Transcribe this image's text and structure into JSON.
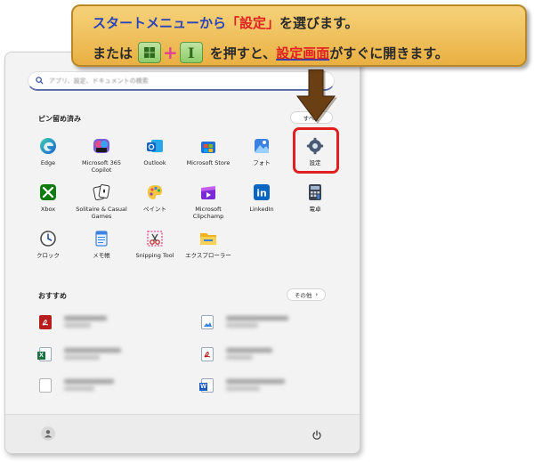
{
  "callout": {
    "line1_part1": "スタートメニューから",
    "line1_highlight": "「設定」",
    "line1_part2": "を選びます。",
    "line2_part1": "または",
    "key1_icon": "windows-key-icon",
    "plus": "+",
    "key2_label": "I",
    "line2_part2": "を押すと、",
    "line2_highlight": "設定画面",
    "line2_part3": "がすぐに開きます。",
    "colors": {
      "accent_blue": "#2a44b8",
      "accent_red": "#e02020",
      "key_green": "#8ecc6b",
      "callout_bg": "#f6d27a"
    }
  },
  "start_menu": {
    "search_placeholder": "アプリ、設定、ドキュメントの検索",
    "pinned_title": "ピン留め済み",
    "all_apps_label": "すべて",
    "recommended_title": "おすすめ",
    "more_label": "その他",
    "pinned_apps": [
      {
        "label": "Edge",
        "icon": "edge-icon"
      },
      {
        "label": "Microsoft 365 Copilot",
        "icon": "m365-copilot-icon"
      },
      {
        "label": "Outlook",
        "icon": "outlook-icon"
      },
      {
        "label": "Microsoft Store",
        "icon": "store-icon"
      },
      {
        "label": "フォト",
        "icon": "photos-icon"
      },
      {
        "label": "設定",
        "icon": "gear-icon"
      },
      {
        "label": "Xbox",
        "icon": "xbox-icon"
      },
      {
        "label": "Solitaire & Casual Games",
        "icon": "solitaire-icon"
      },
      {
        "label": "ペイント",
        "icon": "paint-icon"
      },
      {
        "label": "Microsoft Clipchamp",
        "icon": "clipchamp-icon"
      },
      {
        "label": "LinkedIn",
        "icon": "linkedin-icon"
      },
      {
        "label": "電卓",
        "icon": "calculator-icon"
      },
      {
        "label": "クロック",
        "icon": "clock-icon"
      },
      {
        "label": "メモ帳",
        "icon": "notepad-icon"
      },
      {
        "label": "Snipping Tool",
        "icon": "snipping-tool-icon"
      },
      {
        "label": "エクスプローラー",
        "icon": "file-explorer-icon"
      }
    ],
    "recommended_icons": [
      "pdf-file-icon",
      "image-file-icon",
      "excel-file-icon",
      "pdf-file-icon",
      "blank-file-icon",
      "word-file-icon"
    ]
  }
}
